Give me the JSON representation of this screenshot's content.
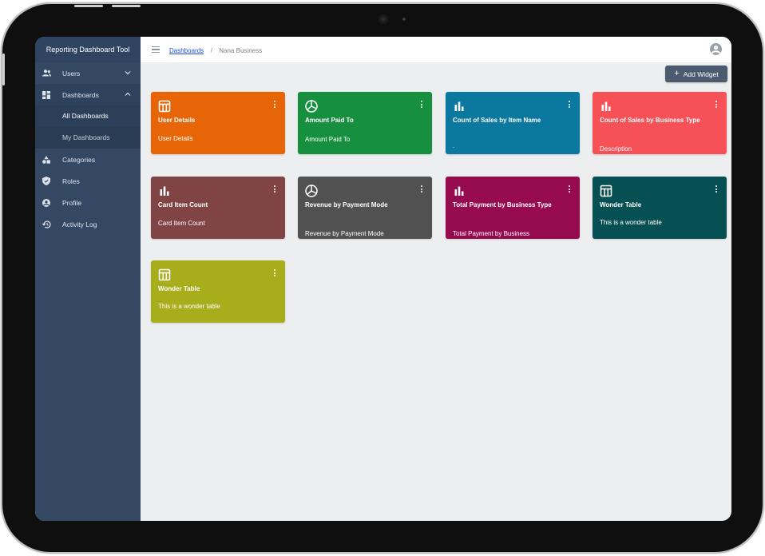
{
  "app": {
    "title": "Reporting Dashboard Tool"
  },
  "sidebar": {
    "items": [
      {
        "label": "Users",
        "icon": "users-icon",
        "expandable": true
      },
      {
        "label": "Dashboards",
        "icon": "dashboard-icon",
        "expandable": true,
        "expanded": true,
        "children": [
          {
            "label": "All Dashboards",
            "active": true
          },
          {
            "label": "My Dashboards"
          }
        ]
      },
      {
        "label": "Categories",
        "icon": "categories-icon"
      },
      {
        "label": "Roles",
        "icon": "shield-icon"
      },
      {
        "label": "Profile",
        "icon": "profile-icon"
      },
      {
        "label": "Activity Log",
        "icon": "history-icon"
      }
    ]
  },
  "topbar": {
    "breadcrumb": {
      "link": "Dashboards",
      "separator": "/",
      "current": "Nana Business"
    }
  },
  "toolbar": {
    "add_widget_label": "Add Widget"
  },
  "widgets": [
    {
      "title": "User Details",
      "description": "User Details",
      "color": "#e86507",
      "icon": "table-icon"
    },
    {
      "title": "Amount Paid To",
      "description": "Amount Paid To",
      "color": "#16903e",
      "icon": "pie-chart-icon"
    },
    {
      "title": "Count of Sales by Item Name",
      "description": ".",
      "color": "#0b789f",
      "icon": "bar-chart-icon"
    },
    {
      "title": "Count of Sales by Business Type",
      "description": "Description",
      "color": "#f55156",
      "icon": "bar-chart-icon"
    },
    {
      "title": "Card Item Count",
      "description": "Card Item Count",
      "color": "#804444",
      "icon": "bar-chart-icon"
    },
    {
      "title": "Revenue by Payment Mode",
      "description": "Revenue by Payment Mode",
      "color": "#515151",
      "icon": "pie-chart-icon"
    },
    {
      "title": "Total Payment by Business Type",
      "description": "Total Payment by Business",
      "color": "#960a50",
      "icon": "bar-chart-icon"
    },
    {
      "title": "Wonder Table",
      "description": "This is a wonder table",
      "color": "#064f52",
      "icon": "table-icon"
    },
    {
      "title": "Wonder Table",
      "description": "This is a wonder table",
      "color": "#a8ad1b",
      "icon": "table-icon"
    }
  ]
}
